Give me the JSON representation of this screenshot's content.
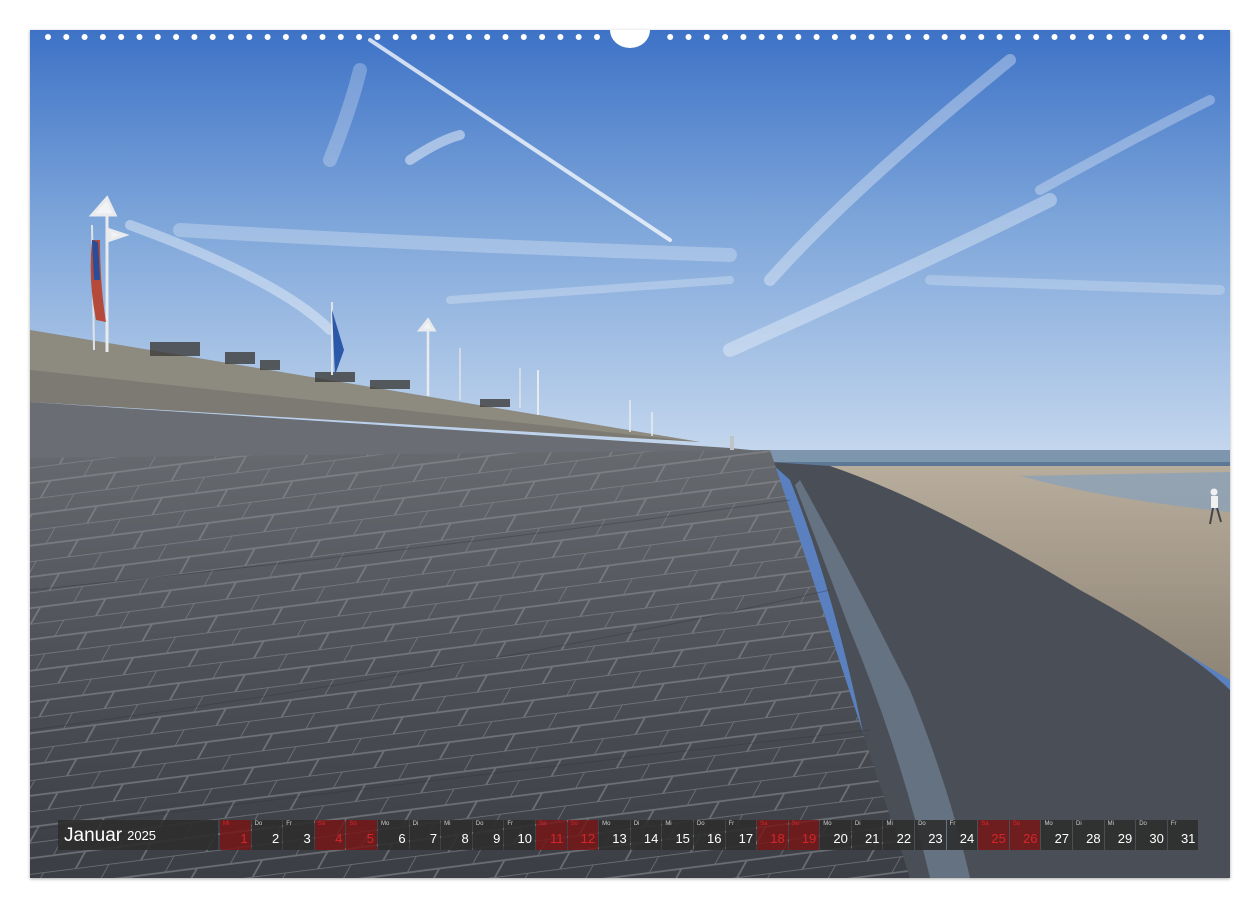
{
  "calendar": {
    "month": "Januar",
    "year": "2025",
    "days": [
      {
        "wd": "Mi",
        "num": "1",
        "weekend": true
      },
      {
        "wd": "Do",
        "num": "2",
        "weekend": false
      },
      {
        "wd": "Fr",
        "num": "3",
        "weekend": false
      },
      {
        "wd": "Sa",
        "num": "4",
        "weekend": true
      },
      {
        "wd": "So",
        "num": "5",
        "weekend": true
      },
      {
        "wd": "Mo",
        "num": "6",
        "weekend": false
      },
      {
        "wd": "Di",
        "num": "7",
        "weekend": false
      },
      {
        "wd": "Mi",
        "num": "8",
        "weekend": false
      },
      {
        "wd": "Do",
        "num": "9",
        "weekend": false
      },
      {
        "wd": "Fr",
        "num": "10",
        "weekend": false
      },
      {
        "wd": "Sa",
        "num": "11",
        "weekend": true
      },
      {
        "wd": "So",
        "num": "12",
        "weekend": true
      },
      {
        "wd": "Mo",
        "num": "13",
        "weekend": false
      },
      {
        "wd": "Di",
        "num": "14",
        "weekend": false
      },
      {
        "wd": "Mi",
        "num": "15",
        "weekend": false
      },
      {
        "wd": "Do",
        "num": "16",
        "weekend": false
      },
      {
        "wd": "Fr",
        "num": "17",
        "weekend": false
      },
      {
        "wd": "Sa",
        "num": "18",
        "weekend": true
      },
      {
        "wd": "So",
        "num": "19",
        "weekend": true
      },
      {
        "wd": "Mo",
        "num": "20",
        "weekend": false
      },
      {
        "wd": "Di",
        "num": "21",
        "weekend": false
      },
      {
        "wd": "Mi",
        "num": "22",
        "weekend": false
      },
      {
        "wd": "Do",
        "num": "23",
        "weekend": false
      },
      {
        "wd": "Fr",
        "num": "24",
        "weekend": false
      },
      {
        "wd": "Sa",
        "num": "25",
        "weekend": true
      },
      {
        "wd": "So",
        "num": "26",
        "weekend": true
      },
      {
        "wd": "Mo",
        "num": "27",
        "weekend": false
      },
      {
        "wd": "Di",
        "num": "28",
        "weekend": false
      },
      {
        "wd": "Mi",
        "num": "29",
        "weekend": false
      },
      {
        "wd": "Do",
        "num": "30",
        "weekend": false
      },
      {
        "wd": "Fr",
        "num": "31",
        "weekend": false
      }
    ]
  },
  "colors": {
    "sky_top": "#3f74c8",
    "sky_horizon": "#c3d6ee",
    "dike_stone": "#565a60",
    "sand": "#a89c8a",
    "sea": "#6f8aa6",
    "weekend_red": "#d4262a"
  }
}
